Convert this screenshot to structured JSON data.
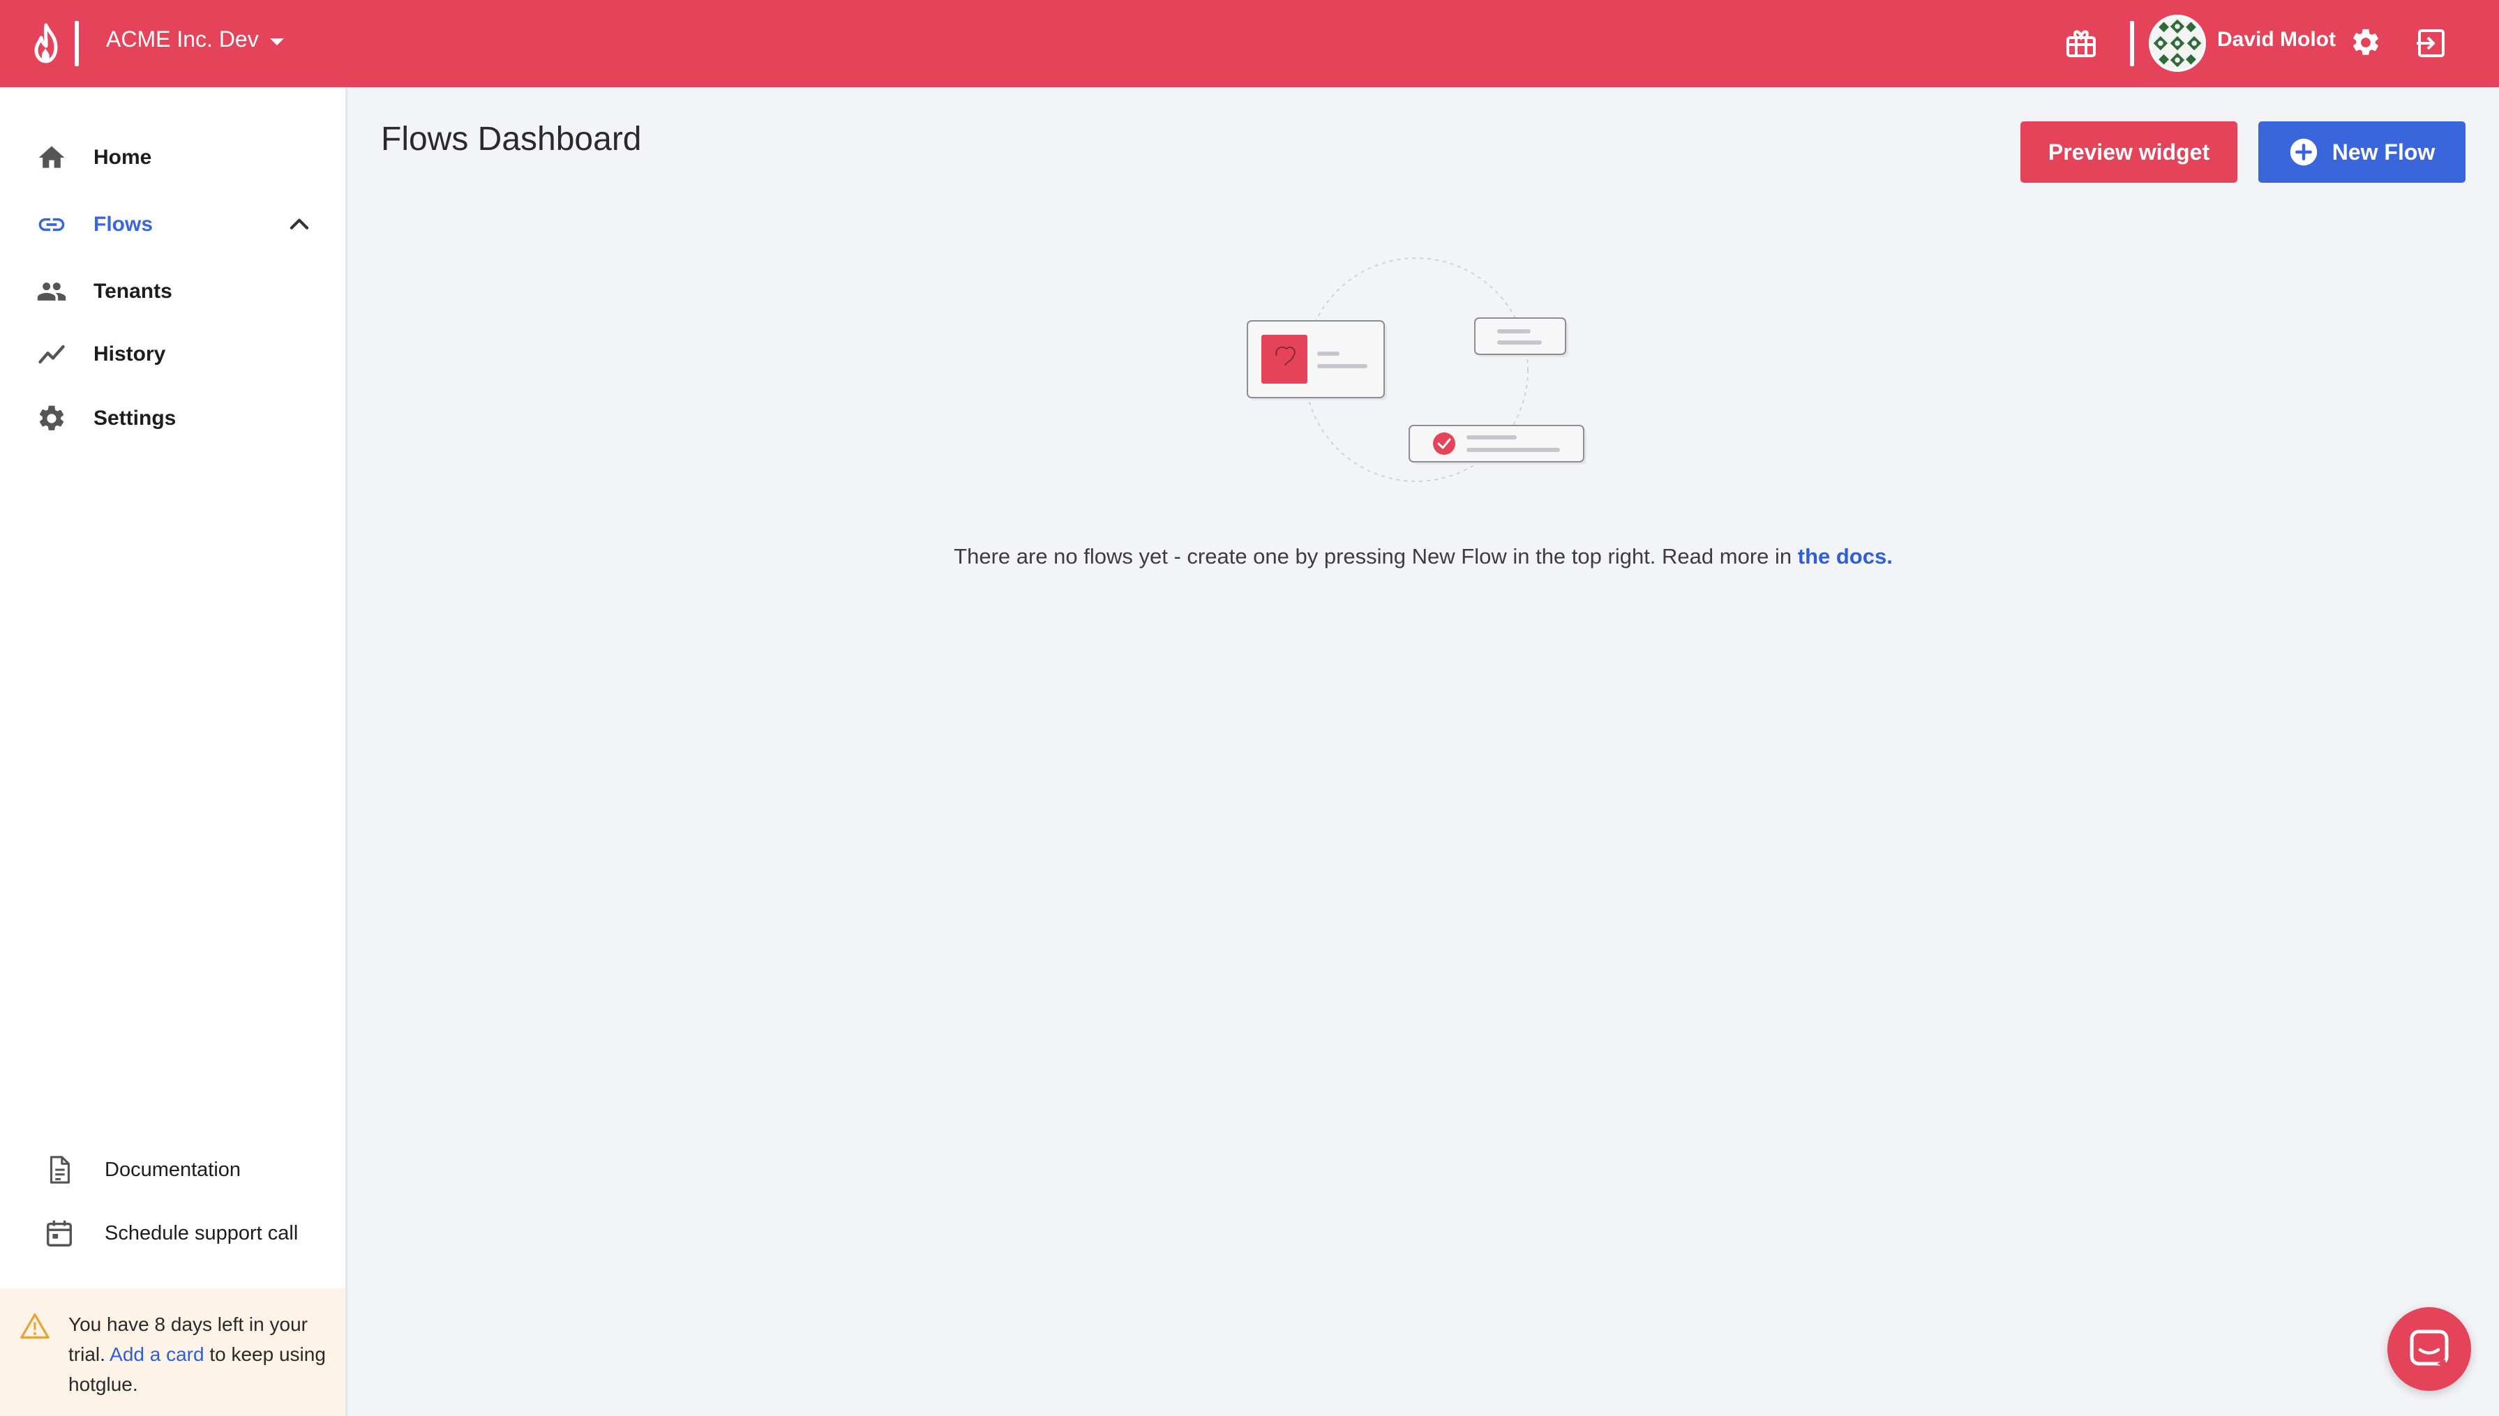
{
  "header": {
    "org_name": "ACME Inc. Dev",
    "user_name": "David Molot",
    "brand_color": "#e5435a"
  },
  "sidebar": {
    "items": [
      {
        "label": "Home",
        "icon": "home-icon"
      },
      {
        "label": "Flows",
        "icon": "link-icon",
        "active": true
      },
      {
        "label": "Tenants",
        "icon": "people-icon"
      },
      {
        "label": "History",
        "icon": "trend-icon"
      },
      {
        "label": "Settings",
        "icon": "gear-icon"
      }
    ],
    "bottom_links": [
      {
        "label": "Documentation",
        "icon": "document-icon"
      },
      {
        "label": "Schedule support call",
        "icon": "calendar-icon"
      }
    ],
    "trial": {
      "text_before": "You have 8 days left in your trial.",
      "link": "Add a card",
      "text_after": "to keep using hotglue."
    }
  },
  "main": {
    "title": "Flows Dashboard",
    "preview_button": "Preview widget",
    "new_button": "New Flow",
    "empty_text": "There are no flows yet - create one by pressing New Flow in the top right. Read more in",
    "docs_link": "the docs."
  },
  "colors": {
    "accent_red": "#e5435a",
    "accent_blue": "#3a66db",
    "link_blue": "#2f5fd6",
    "trial_bg": "#fdf3e7"
  }
}
